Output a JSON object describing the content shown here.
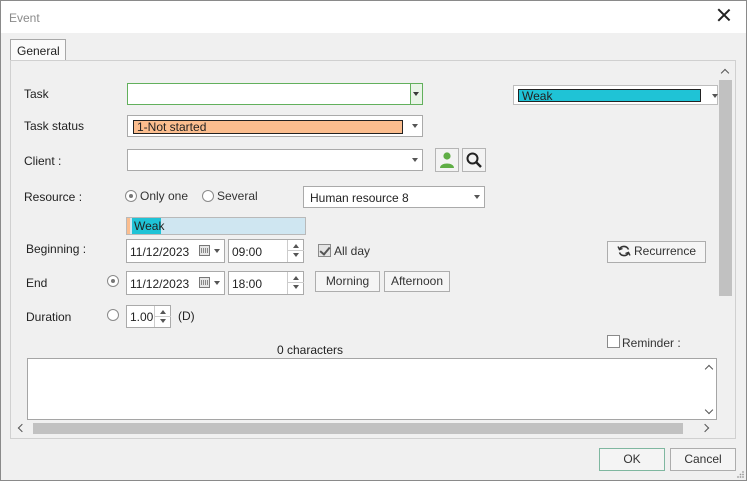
{
  "window": {
    "title": "Event"
  },
  "tabs": [
    {
      "label": "General"
    }
  ],
  "task": {
    "label": "Task",
    "value": "",
    "priority": {
      "value": "Weak",
      "color": "#1fc3d6"
    }
  },
  "task_status": {
    "label": "Task status",
    "value": "1-Not started",
    "color": "#fbbd8e"
  },
  "client": {
    "label": "Client :",
    "value": "",
    "icons": [
      "person-icon",
      "search-icon"
    ]
  },
  "resource": {
    "label": "Resource :",
    "options": [
      "Only one",
      "Several"
    ],
    "selected": "Only one",
    "value": "Human resource 8",
    "level": {
      "value": "Weak",
      "color": "#1fc3d6",
      "track_color": "#cfe6f1"
    }
  },
  "beginning": {
    "label": "Beginning :",
    "date": "11/12/2023",
    "time": "09:00",
    "all_day_label": "All day",
    "all_day": true
  },
  "recurrence_button": "Recurrence",
  "end": {
    "label": "End",
    "date": "11/12/2023",
    "time": "18:00",
    "morning_button": "Morning",
    "afternoon_button": "Afternoon"
  },
  "duration": {
    "label": "Duration",
    "value": "1.00",
    "unit": "(D)"
  },
  "reminder": {
    "label": "Reminder :",
    "checked": false
  },
  "memo": {
    "counter": "0 characters",
    "text": ""
  },
  "footer": {
    "ok_label": "OK",
    "cancel_label": "Cancel"
  }
}
